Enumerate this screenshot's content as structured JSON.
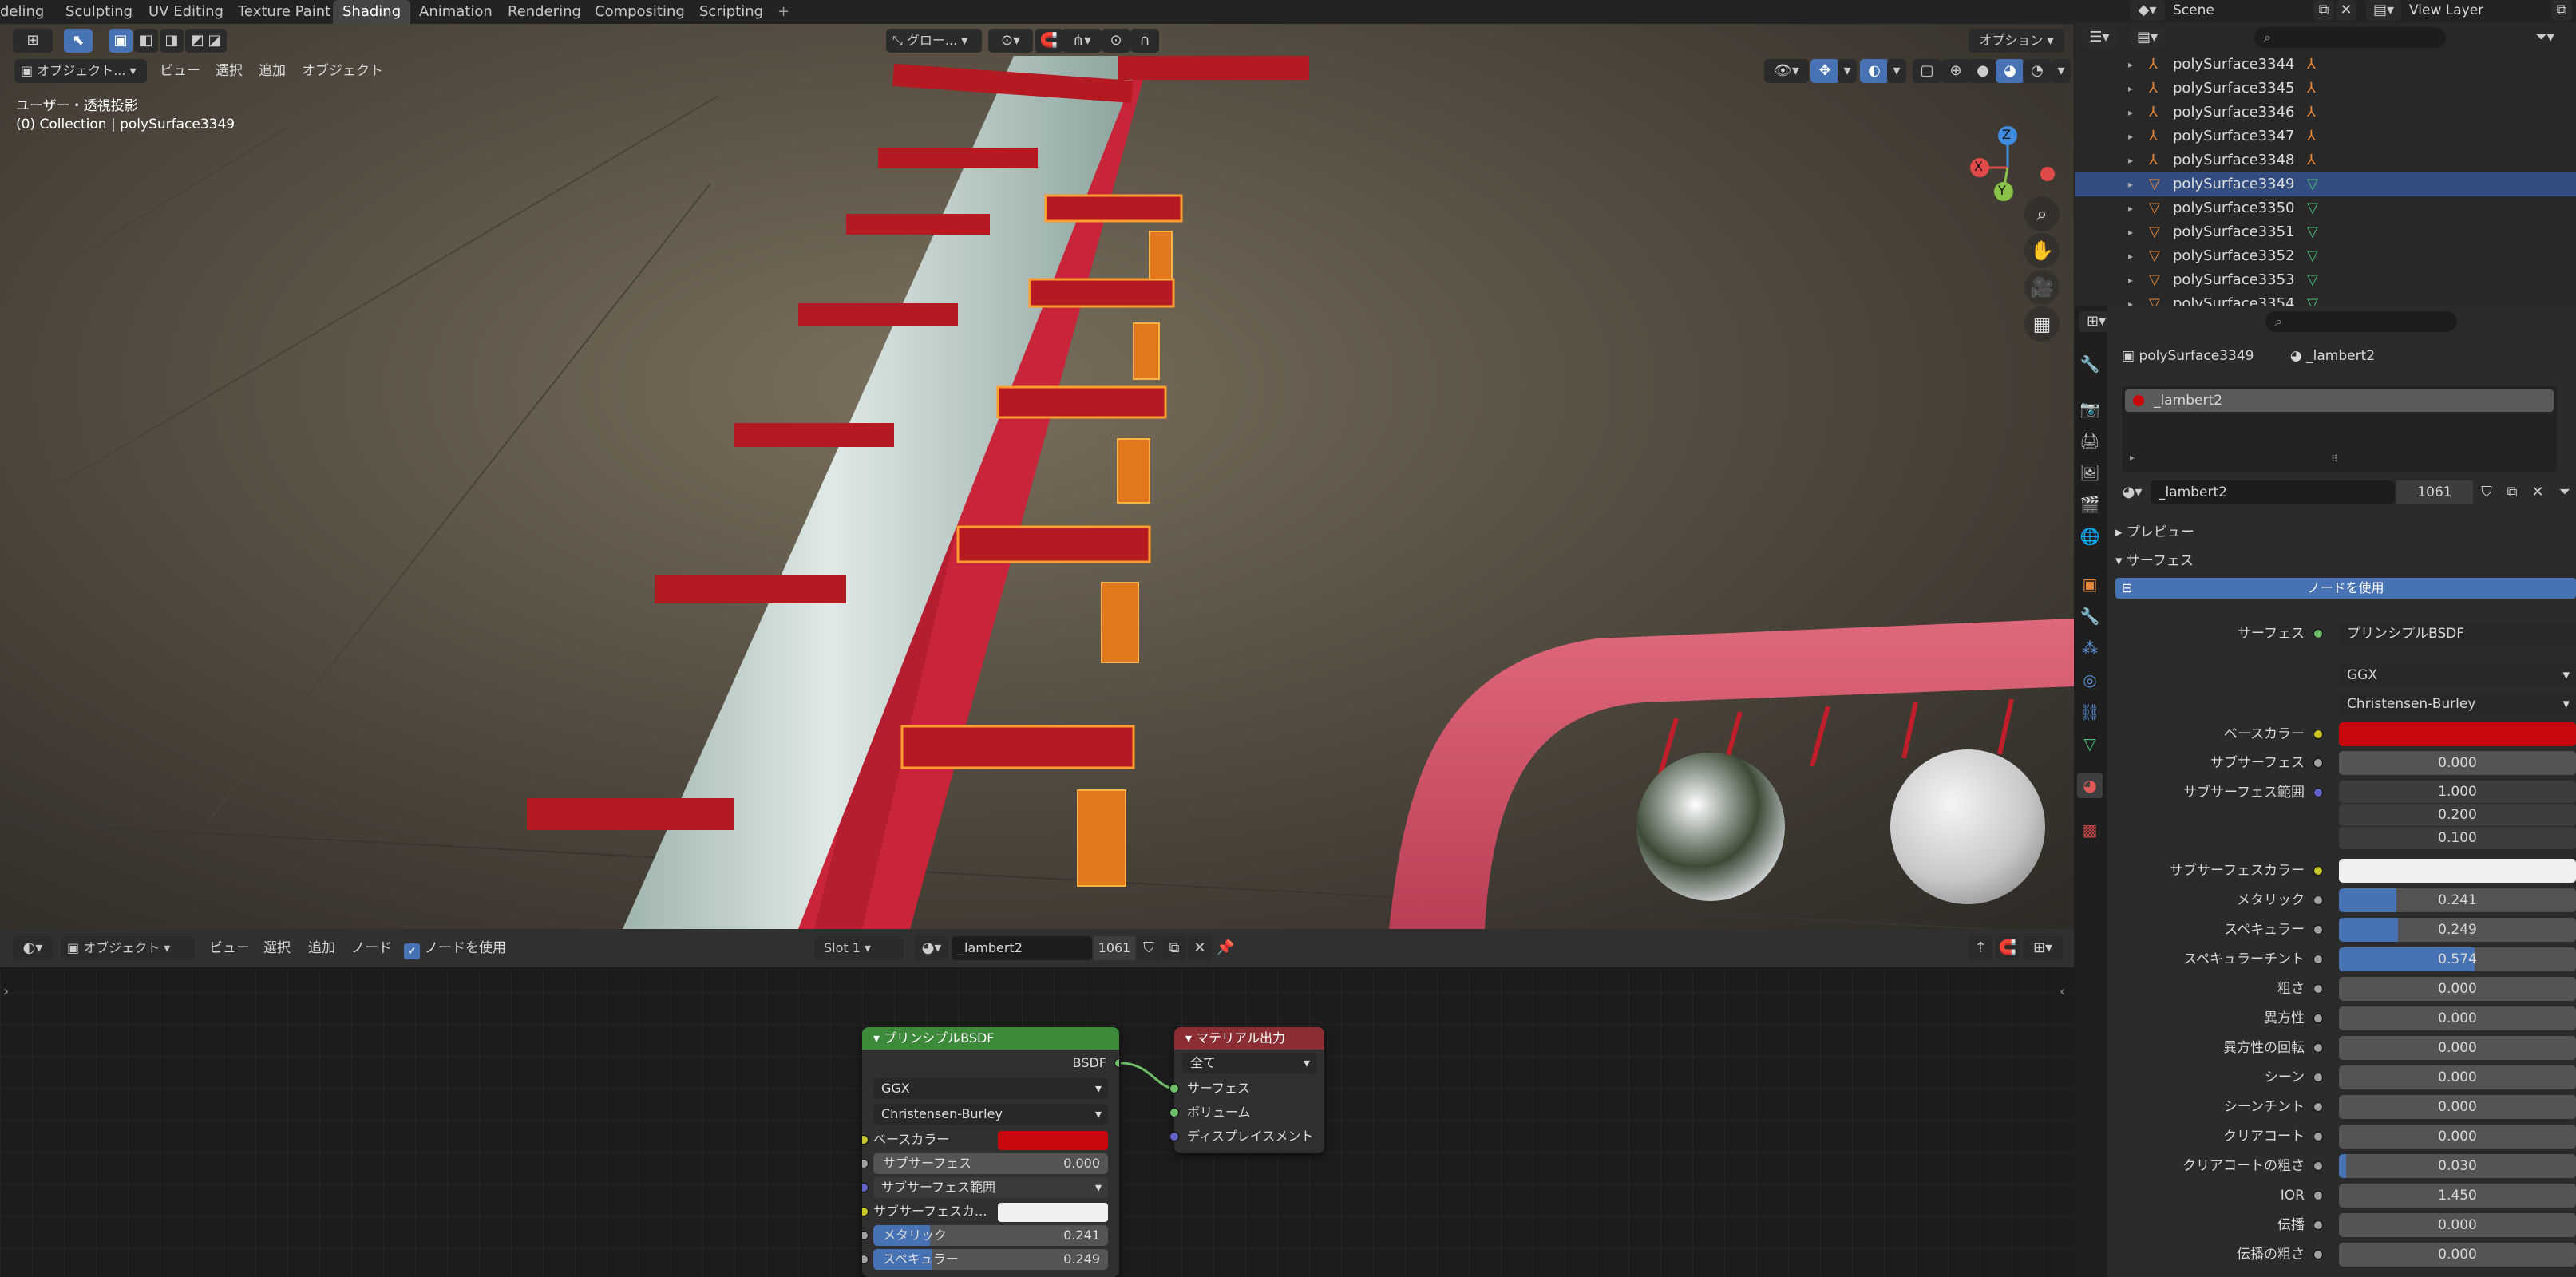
{
  "workspace_tabs": [
    "deling",
    "Sculpting",
    "UV Editing",
    "Texture Paint",
    "Shading",
    "Animation",
    "Rendering",
    "Compositing",
    "Scripting",
    "+"
  ],
  "active_tab": "Shading",
  "scene": "Scene",
  "view_layer": "View Layer",
  "viewport": {
    "mode": "オブジェクト...",
    "menu": [
      "ビュー",
      "選択",
      "追加",
      "オブジェクト"
    ],
    "orientation": "グロー...",
    "options": "オプション",
    "view_name": "ユーザー・透視投影",
    "collection_info": "(0) Collection | polySurface3349",
    "gizmo": {
      "x": "X",
      "y": "Y",
      "z": "Z"
    }
  },
  "outliner": {
    "items": [
      {
        "name": "polySurface3344",
        "type": "empty"
      },
      {
        "name": "polySurface3345",
        "type": "empty"
      },
      {
        "name": "polySurface3346",
        "type": "empty"
      },
      {
        "name": "polySurface3347",
        "type": "empty"
      },
      {
        "name": "polySurface3348",
        "type": "empty"
      },
      {
        "name": "polySurface3349",
        "type": "mesh",
        "selected": true
      },
      {
        "name": "polySurface3350",
        "type": "mesh"
      },
      {
        "name": "polySurface3351",
        "type": "mesh"
      },
      {
        "name": "polySurface3352",
        "type": "mesh"
      },
      {
        "name": "polySurface3353",
        "type": "mesh"
      },
      {
        "name": "polySurface3354",
        "type": "mesh"
      }
    ]
  },
  "properties": {
    "object": "polySurface3349",
    "material": "_lambert2",
    "slot": "_lambert2",
    "material_field": "_lambert2",
    "users": "1061",
    "section_preview": "プレビュー",
    "section_surface": "サーフェス",
    "use_nodes": "ノードを使用",
    "surface_label": "サーフェス",
    "surface_value": "プリンシプルBSDF",
    "distribution": "GGX",
    "sss_method": "Christensen-Burley",
    "base_color_label": "ベースカラー",
    "base_color": "#c8080d",
    "subsurface_color": "#f0f0f0",
    "rows": [
      {
        "label": "サブサーフェス",
        "value": "0.000",
        "fill": 0
      },
      {
        "label": "メタリック",
        "value": "0.241",
        "fill": 0.241
      },
      {
        "label": "スペキュラー",
        "value": "0.249",
        "fill": 0.249
      },
      {
        "label": "スペキュラーチント",
        "value": "0.574",
        "fill": 0.574
      },
      {
        "label": "粗さ",
        "value": "0.000",
        "fill": 0
      },
      {
        "label": "異方性",
        "value": "0.000",
        "fill": 0
      },
      {
        "label": "異方性の回転",
        "value": "0.000",
        "fill": 0
      },
      {
        "label": "シーン",
        "value": "0.000",
        "fill": 0
      },
      {
        "label": "シーンチント",
        "value": "0.000",
        "fill": 0
      },
      {
        "label": "クリアコート",
        "value": "0.000",
        "fill": 0
      },
      {
        "label": "クリアコートの粗さ",
        "value": "0.030",
        "fill": 0.03
      },
      {
        "label": "IOR",
        "value": "1.450",
        "fill": 0
      },
      {
        "label": "伝播",
        "value": "0.000",
        "fill": 0
      },
      {
        "label": "伝播の粗さ",
        "value": "0.000",
        "fill": 0
      }
    ],
    "sss_range_label": "サブサーフェス範囲",
    "sss_range": [
      "1.000",
      "0.200",
      "0.100"
    ],
    "sss_color_label": "サブサーフェスカラー"
  },
  "node_editor": {
    "mode": "オブジェクト",
    "menu": [
      "ビュー",
      "選択",
      "追加",
      "ノード"
    ],
    "use_nodes": "ノードを使用",
    "slot": "Slot 1",
    "material": "_lambert2",
    "users": "1061",
    "bsdf_node": {
      "title": "プリンシプルBSDF",
      "output": "BSDF",
      "distribution": "GGX",
      "sss_method": "Christensen-Burley",
      "base_color": "ベースカラー",
      "subsurface": "サブサーフェス",
      "subsurface_value": "0.000",
      "sss_range": "サブサーフェス範囲",
      "sss_color": "サブサーフェスカ...",
      "metallic": "メタリック",
      "metallic_value": "0.241",
      "specular": "スペキュラー",
      "specular_value": "0.249"
    },
    "output_node": {
      "title": "マテリアル出力",
      "target": "全て",
      "surface": "サーフェス",
      "volume": "ボリューム",
      "displacement": "ディスプレイスメント"
    }
  }
}
